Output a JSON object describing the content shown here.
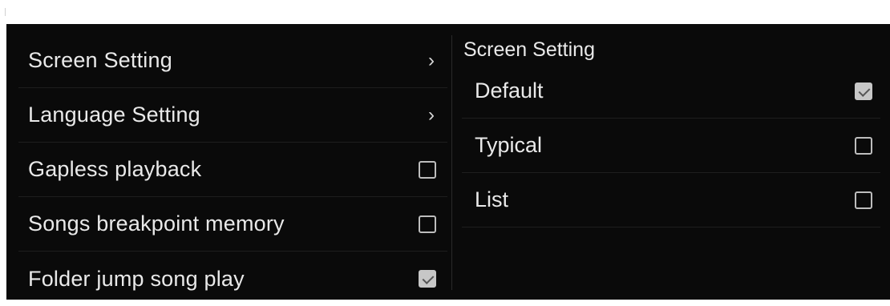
{
  "settings_menu": {
    "items": [
      {
        "label": "Screen Setting",
        "control": "chevron",
        "glyph": "›"
      },
      {
        "label": "Language Setting",
        "control": "chevron",
        "glyph": "›"
      },
      {
        "label": "Gapless playback",
        "control": "checkbox",
        "checked": false
      },
      {
        "label": "Songs breakpoint memory",
        "control": "checkbox",
        "checked": false
      },
      {
        "label": "Folder jump song play",
        "control": "checkbox",
        "checked": true
      }
    ]
  },
  "screen_setting_panel": {
    "title": "Screen Setting",
    "options": [
      {
        "label": "Default",
        "checked": true
      },
      {
        "label": "Typical",
        "checked": false
      },
      {
        "label": "List",
        "checked": false
      }
    ]
  },
  "colors": {
    "panel_background": "#0a0a0a",
    "text": "#e9e9e9",
    "checkbox": "#bdbdbd"
  }
}
